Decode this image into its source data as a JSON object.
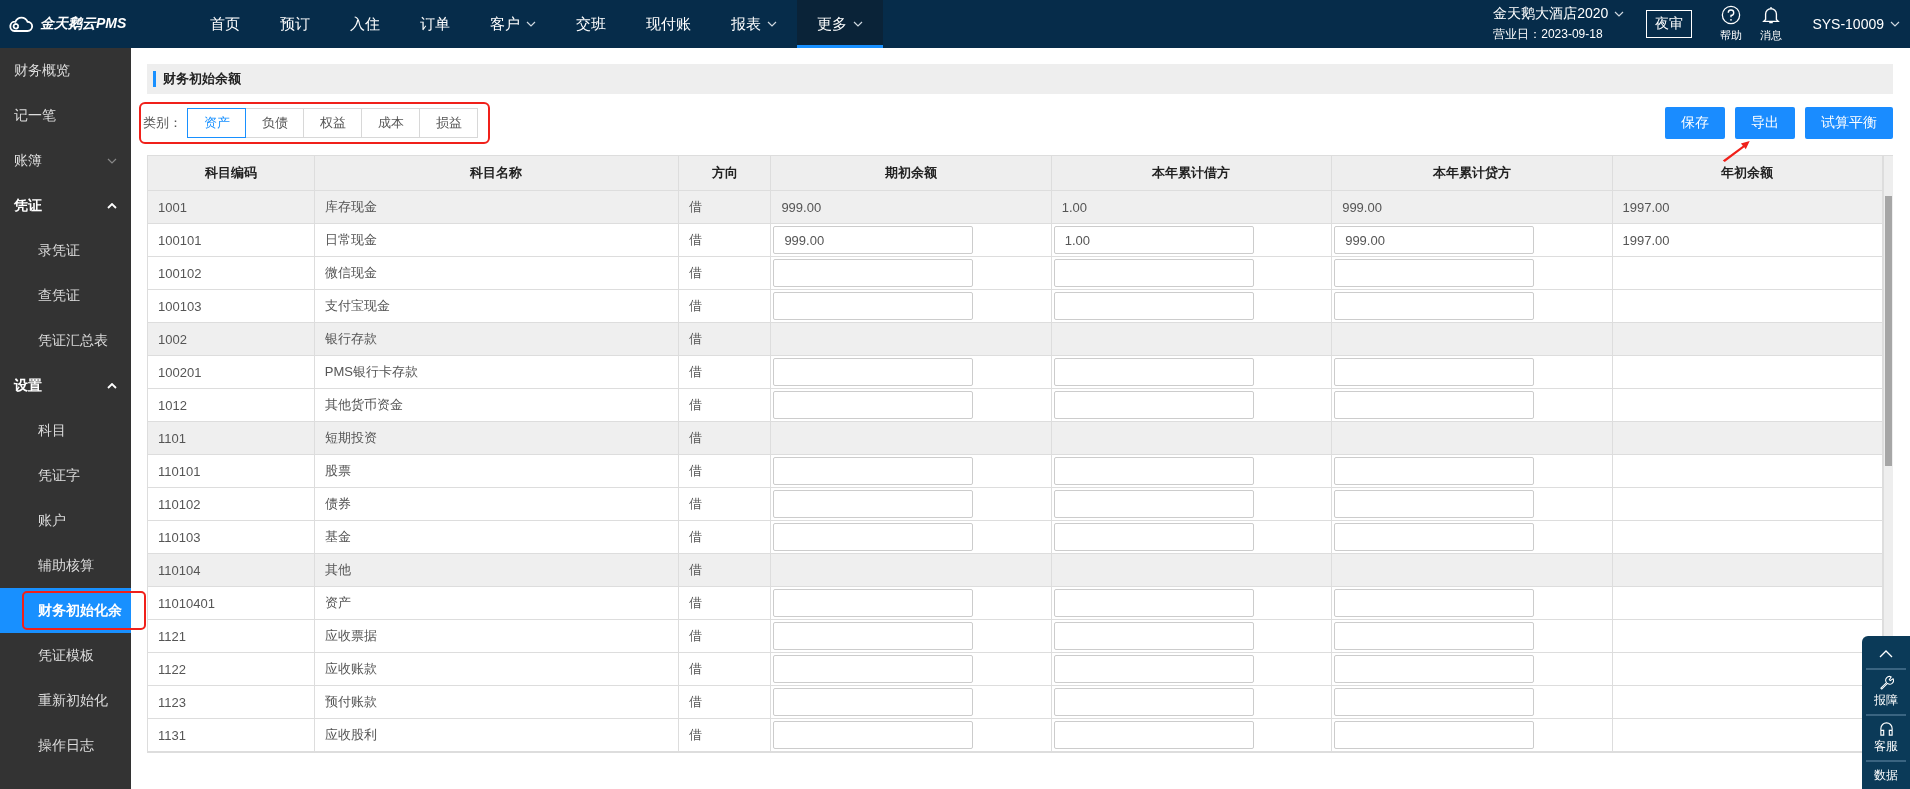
{
  "topbar": {
    "logo": "金天鹅云PMS",
    "nav": [
      {
        "label": "首页",
        "dropdown": false,
        "selected": false
      },
      {
        "label": "预订",
        "dropdown": false,
        "selected": false
      },
      {
        "label": "入住",
        "dropdown": false,
        "selected": false
      },
      {
        "label": "订单",
        "dropdown": false,
        "selected": false
      },
      {
        "label": "客户",
        "dropdown": true,
        "selected": false
      },
      {
        "label": "交班",
        "dropdown": false,
        "selected": false
      },
      {
        "label": "现付账",
        "dropdown": false,
        "selected": false
      },
      {
        "label": "报表",
        "dropdown": true,
        "selected": false
      },
      {
        "label": "更多",
        "dropdown": true,
        "selected": true
      }
    ],
    "hotel": "金天鹅大酒店2020",
    "business_day": "营业日：2023-09-18",
    "night_audit": "夜审",
    "help": "帮助",
    "messages": "消息",
    "user": "SYS-10009"
  },
  "sidebar": {
    "items": [
      {
        "label": "财务概览",
        "selected": false
      },
      {
        "label": "记一笔",
        "selected": false
      },
      {
        "label": "账簿",
        "selected": false,
        "expanded": false
      },
      {
        "label": "凭证",
        "selected": false,
        "expanded": true,
        "children": [
          {
            "label": "录凭证",
            "selected": false,
            "annotated": false
          },
          {
            "label": "查凭证",
            "selected": false,
            "annotated": false
          },
          {
            "label": "凭证汇总表",
            "selected": false,
            "annotated": false
          }
        ]
      },
      {
        "label": "设置",
        "selected": false,
        "expanded": true,
        "children": [
          {
            "label": "科目",
            "selected": false,
            "annotated": false
          },
          {
            "label": "凭证字",
            "selected": false,
            "annotated": false
          },
          {
            "label": "账户",
            "selected": false,
            "annotated": false
          },
          {
            "label": "辅助核算",
            "selected": false,
            "annotated": false
          },
          {
            "label": "财务初始化余",
            "selected": true,
            "annotated": true
          },
          {
            "label": "凭证模板",
            "selected": false,
            "annotated": false
          },
          {
            "label": "重新初始化",
            "selected": false,
            "annotated": false
          },
          {
            "label": "操作日志",
            "selected": false,
            "annotated": false
          }
        ]
      }
    ]
  },
  "page": {
    "title": "财务初始余额",
    "category_label": "类别：",
    "categories_annotated": true,
    "categories": [
      {
        "label": "资产",
        "selected": true
      },
      {
        "label": "负债",
        "selected": false
      },
      {
        "label": "权益",
        "selected": false
      },
      {
        "label": "成本",
        "selected": false
      },
      {
        "label": "损益",
        "selected": false
      }
    ],
    "buttons": [
      {
        "label": "保存",
        "annotated": false
      },
      {
        "label": "导出",
        "annotated": true
      },
      {
        "label": "试算平衡",
        "annotated": false
      }
    ],
    "table": {
      "columns": [
        "科目编码",
        "科目名称",
        "方向",
        "期初余额",
        "本年累计借方",
        "本年累计贷方",
        "年初余额"
      ],
      "rows": [
        {
          "code": "1001",
          "name": "库存现金",
          "direction": "借",
          "editable": false,
          "opening": "999.00",
          "debit": "1.00",
          "credit": "999.00",
          "year_start": "1997.00"
        },
        {
          "code": "100101",
          "name": "日常现金",
          "direction": "借",
          "editable": true,
          "opening": "999.00",
          "debit": "1.00",
          "credit": "999.00",
          "year_start": "1997.00"
        },
        {
          "code": "100102",
          "name": "微信现金",
          "direction": "借",
          "editable": true
        },
        {
          "code": "100103",
          "name": "支付宝现金",
          "direction": "借",
          "editable": true
        },
        {
          "code": "1002",
          "name": "银行存款",
          "direction": "借",
          "editable": false
        },
        {
          "code": "100201",
          "name": "PMS银行卡存款",
          "direction": "借",
          "editable": true
        },
        {
          "code": "1012",
          "name": "其他货币资金",
          "direction": "借",
          "editable": true
        },
        {
          "code": "1101",
          "name": "短期投资",
          "direction": "借",
          "editable": false
        },
        {
          "code": "110101",
          "name": "股票",
          "direction": "借",
          "editable": true
        },
        {
          "code": "110102",
          "name": "债券",
          "direction": "借",
          "editable": true
        },
        {
          "code": "110103",
          "name": "基金",
          "direction": "借",
          "editable": true
        },
        {
          "code": "110104",
          "name": "其他",
          "direction": "借",
          "editable": false
        },
        {
          "code": "11010401",
          "name": "资产",
          "direction": "借",
          "editable": true
        },
        {
          "code": "1121",
          "name": "应收票据",
          "direction": "借",
          "editable": true
        },
        {
          "code": "1122",
          "name": "应收账款",
          "direction": "借",
          "editable": true
        },
        {
          "code": "1123",
          "name": "预付账款",
          "direction": "借",
          "editable": true
        },
        {
          "code": "1131",
          "name": "应收股利",
          "direction": "借",
          "editable": true
        }
      ]
    }
  },
  "float_tools": {
    "items": [
      {
        "kind": "wrench",
        "label": "报障"
      },
      {
        "kind": "headset",
        "label": "客服"
      },
      {
        "kind": "plain",
        "label": "数据"
      }
    ]
  }
}
